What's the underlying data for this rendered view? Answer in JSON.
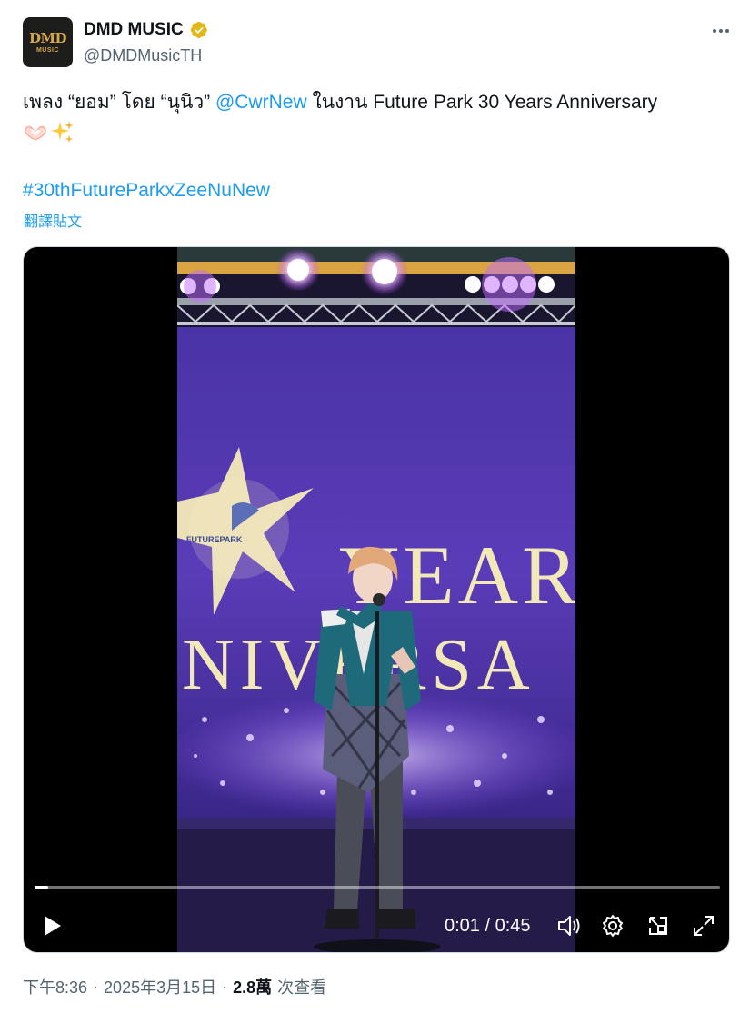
{
  "author": {
    "display_name": "DMD MUSIC",
    "handle": "@DMDMusicTH",
    "avatar_text_top": "DMD",
    "avatar_text_bottom": "MUSIC",
    "verified": true,
    "verified_color": "#e2b719"
  },
  "tweet": {
    "text_before": "เพลง “ยอม” โดย “นุนิว” ",
    "mention": "@CwrNew",
    "text_after": " ในงาน Future Park 30 Years Anniversary",
    "emojis": [
      "hand-heart-icon",
      "sparkles-icon"
    ],
    "hashtag": "#30thFutureParkxZeeNuNew",
    "translate_label": "翻譯貼文"
  },
  "video": {
    "overlay_text_years": "YEAR",
    "overlay_text_anniversary": "NIVERSA",
    "overlay_brand": "FUTUREPARK",
    "current_time": "0:01",
    "duration": "0:45",
    "time_display": "0:01 / 0:45",
    "progress_fraction": 0.02,
    "controls": [
      "play-icon",
      "volume-icon",
      "settings-icon",
      "pip-icon",
      "fullscreen-icon"
    ]
  },
  "meta": {
    "time": "下午8:36",
    "date": "2025年3月15日",
    "views_count": "2.8萬",
    "views_label": "次查看",
    "separator": "·"
  },
  "colors": {
    "link": "#1d9bf0",
    "secondary_text": "#536471",
    "primary_text": "#0f1419",
    "stage_purple": "#5b3fb5"
  }
}
